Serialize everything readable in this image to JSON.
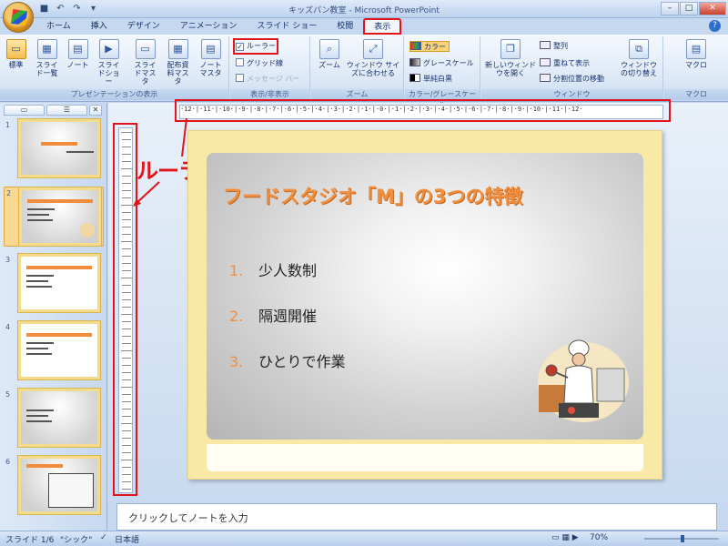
{
  "window": {
    "title": "キッズパン教室 - Microsoft PowerPoint"
  },
  "qat": {
    "save": "save-icon",
    "undo": "undo-icon",
    "redo": "redo-icon"
  },
  "tabs": [
    "ホーム",
    "挿入",
    "デザイン",
    "アニメーション",
    "スライド ショー",
    "校閲",
    "表示"
  ],
  "active_tab": "表示",
  "ribbon": {
    "presentation_views": {
      "label": "プレゼンテーションの表示",
      "buttons": [
        "標準",
        "スライド一覧",
        "ノート",
        "スライドショー",
        "スライドマスタ",
        "配布資料マスタ",
        "ノートマスタ"
      ]
    },
    "show_hide": {
      "label": "表示/非表示",
      "ruler": "ルーラー",
      "ruler_checked": true,
      "gridlines": "グリッド線",
      "message_bar": "メッセージ バー"
    },
    "zoom": {
      "label": "ズーム",
      "zoom": "ズーム",
      "fit": "ウィンドウ サイズに合わせる"
    },
    "color": {
      "label": "カラー/グレースケール",
      "color": "カラー",
      "grayscale": "グレースケール",
      "bw": "単純白黒"
    },
    "window": {
      "label": "ウィンドウ",
      "new_window": "新しいウィンドウを開く",
      "arrange_all": "整列",
      "cascade": "重ねて表示",
      "move_split": "分割位置の移動",
      "switch": "ウィンドウの切り替え"
    },
    "macro": {
      "label": "マクロ",
      "button": "マクロ"
    }
  },
  "slides_panel": {
    "tab1": "スライド",
    "tab2": "アウトライン",
    "slides": [
      {
        "num": "1",
        "selected": false
      },
      {
        "num": "2",
        "selected": true
      },
      {
        "num": "3",
        "selected": false
      },
      {
        "num": "4",
        "selected": false
      },
      {
        "num": "5",
        "selected": false
      },
      {
        "num": "6",
        "selected": false
      }
    ]
  },
  "ruler_text": "·12·|·11·|·10·|·9·|·8·|·7·|·6·|·5·|·4·|·3·|·2·|·1·|·0·|·1·|·2·|·3·|·4·|·5·|·6·|·7·|·8·|·9·|·10·|·11·|·12·",
  "annotation": {
    "callout": "ルーラー"
  },
  "slide": {
    "title": "フードスタジオ「M」の3つの特徴",
    "bullets": [
      {
        "n": "1.",
        "text": "少人数制"
      },
      {
        "n": "2.",
        "text": "隔週開催"
      },
      {
        "n": "3.",
        "text": "ひとりで作業"
      }
    ]
  },
  "notes": {
    "placeholder": "クリックしてノートを入力"
  },
  "status": {
    "slide": "スライド 1/6",
    "theme": "\"シック\"",
    "lang": "日本語",
    "zoom": "70%"
  },
  "colors": {
    "accent": "#f18f3e",
    "highlight": "#e0141a",
    "slide_border": "#f8e9a6"
  }
}
